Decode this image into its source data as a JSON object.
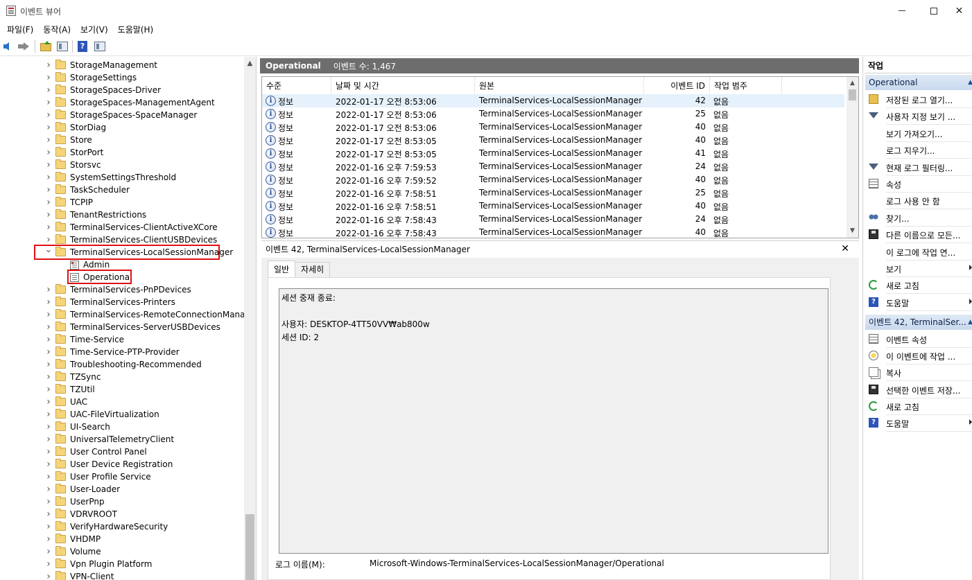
{
  "window": {
    "title": "이벤트 뷰어"
  },
  "menu": {
    "file": "파일(F)",
    "action": "동작(A)",
    "view": "보기(V)",
    "help": "도움말(H)"
  },
  "tree": {
    "items": [
      {
        "label": "StorageManagement"
      },
      {
        "label": "StorageSettings"
      },
      {
        "label": "StorageSpaces-Driver"
      },
      {
        "label": "StorageSpaces-ManagementAgent"
      },
      {
        "label": "StorageSpaces-SpaceManager"
      },
      {
        "label": "StorDiag"
      },
      {
        "label": "Store"
      },
      {
        "label": "StorPort"
      },
      {
        "label": "Storsvc"
      },
      {
        "label": "SystemSettingsThreshold"
      },
      {
        "label": "TaskScheduler"
      },
      {
        "label": "TCPIP"
      },
      {
        "label": "TenantRestrictions"
      },
      {
        "label": "TerminalServices-ClientActiveXCore"
      },
      {
        "label": "TerminalServices-ClientUSBDevices"
      },
      {
        "label": "TerminalServices-LocalSessionManager"
      },
      {
        "label": "Admin"
      },
      {
        "label": "Operational"
      },
      {
        "label": "TerminalServices-PnPDevices"
      },
      {
        "label": "TerminalServices-Printers"
      },
      {
        "label": "TerminalServices-RemoteConnectionManager"
      },
      {
        "label": "TerminalServices-ServerUSBDevices"
      },
      {
        "label": "Time-Service"
      },
      {
        "label": "Time-Service-PTP-Provider"
      },
      {
        "label": "Troubleshooting-Recommended"
      },
      {
        "label": "TZSync"
      },
      {
        "label": "TZUtil"
      },
      {
        "label": "UAC"
      },
      {
        "label": "UAC-FileVirtualization"
      },
      {
        "label": "UI-Search"
      },
      {
        "label": "UniversalTelemetryClient"
      },
      {
        "label": "User Control Panel"
      },
      {
        "label": "User Device Registration"
      },
      {
        "label": "User Profile Service"
      },
      {
        "label": "User-Loader"
      },
      {
        "label": "UserPnp"
      },
      {
        "label": "VDRVROOT"
      },
      {
        "label": "VerifyHardwareSecurity"
      },
      {
        "label": "VHDMP"
      },
      {
        "label": "Volume"
      },
      {
        "label": "Vpn Plugin Platform"
      },
      {
        "label": "VPN-Client"
      }
    ]
  },
  "list": {
    "log_name": "Operational",
    "event_count": "이벤트 수: 1,467",
    "columns": [
      "수준",
      "날짜 및 시간",
      "원본",
      "이벤트 ID",
      "작업 범주"
    ],
    "rows": [
      {
        "level": "정보",
        "datetime": "2022-01-17 오전 8:53:06",
        "source": "TerminalServices-LocalSessionManager",
        "id": "42",
        "category": "없음"
      },
      {
        "level": "정보",
        "datetime": "2022-01-17 오전 8:53:06",
        "source": "TerminalServices-LocalSessionManager",
        "id": "25",
        "category": "없음"
      },
      {
        "level": "정보",
        "datetime": "2022-01-17 오전 8:53:06",
        "source": "TerminalServices-LocalSessionManager",
        "id": "40",
        "category": "없음"
      },
      {
        "level": "정보",
        "datetime": "2022-01-17 오전 8:53:05",
        "source": "TerminalServices-LocalSessionManager",
        "id": "40",
        "category": "없음"
      },
      {
        "level": "정보",
        "datetime": "2022-01-17 오전 8:53:05",
        "source": "TerminalServices-LocalSessionManager",
        "id": "41",
        "category": "없음"
      },
      {
        "level": "정보",
        "datetime": "2022-01-16 오후 7:59:53",
        "source": "TerminalServices-LocalSessionManager",
        "id": "24",
        "category": "없음"
      },
      {
        "level": "정보",
        "datetime": "2022-01-16 오후 7:59:52",
        "source": "TerminalServices-LocalSessionManager",
        "id": "40",
        "category": "없음"
      },
      {
        "level": "정보",
        "datetime": "2022-01-16 오후 7:58:51",
        "source": "TerminalServices-LocalSessionManager",
        "id": "25",
        "category": "없음"
      },
      {
        "level": "정보",
        "datetime": "2022-01-16 오후 7:58:51",
        "source": "TerminalServices-LocalSessionManager",
        "id": "40",
        "category": "없음"
      },
      {
        "level": "정보",
        "datetime": "2022-01-16 오후 7:58:43",
        "source": "TerminalServices-LocalSessionManager",
        "id": "24",
        "category": "없음"
      },
      {
        "level": "정보",
        "datetime": "2022-01-16 오후 7:58:43",
        "source": "TerminalServices-LocalSessionManager",
        "id": "40",
        "category": "없음"
      }
    ]
  },
  "detail": {
    "title": "이벤트 42, TerminalServices-LocalSessionManager",
    "tab_general": "일반",
    "tab_details": "자세히",
    "description": "세션 중재 종료:\n\n사용자: DESKTOP-4TT50VV₩ab800w\n세션 ID: 2",
    "log_name_label": "로그 이름(M):",
    "log_name_value": "Microsoft-Windows-TerminalServices-LocalSessionManager/Operational"
  },
  "actions": {
    "header": "작업",
    "section1": "Operational",
    "items1": [
      {
        "label": "저장된 로그 열기...",
        "icon": "open-folder-icon"
      },
      {
        "label": "사용자 지정 보기 ...",
        "icon": "filter-icon"
      },
      {
        "label": "보기 가져오기...",
        "icon": ""
      },
      {
        "label": "로그 지우기...",
        "icon": ""
      },
      {
        "label": "현재 로그 필터링...",
        "icon": "filter-icon"
      },
      {
        "label": "속성",
        "icon": "properties-icon"
      },
      {
        "label": "로그 사용 안 함",
        "icon": ""
      },
      {
        "label": "찾기...",
        "icon": "binoculars-icon"
      },
      {
        "label": "다른 이름으로 모든...",
        "icon": "save-icon"
      },
      {
        "label": "이 로그에 작업 연...",
        "icon": ""
      },
      {
        "label": "보기",
        "icon": ""
      },
      {
        "label": "새로 고침",
        "icon": "refresh-icon"
      },
      {
        "label": "도움말",
        "icon": "help-icon"
      }
    ],
    "section2": "이벤트 42, TerminalSer...",
    "items2": [
      {
        "label": "이벤트 속성",
        "icon": "properties-icon"
      },
      {
        "label": "이 이벤트에 작업 ...",
        "icon": "task-icon"
      },
      {
        "label": "복사",
        "icon": "copy-icon"
      },
      {
        "label": "선택한 이벤트 저장...",
        "icon": "save-icon"
      },
      {
        "label": "새로 고침",
        "icon": "refresh-icon"
      },
      {
        "label": "도움말",
        "icon": "help-icon"
      }
    ]
  }
}
